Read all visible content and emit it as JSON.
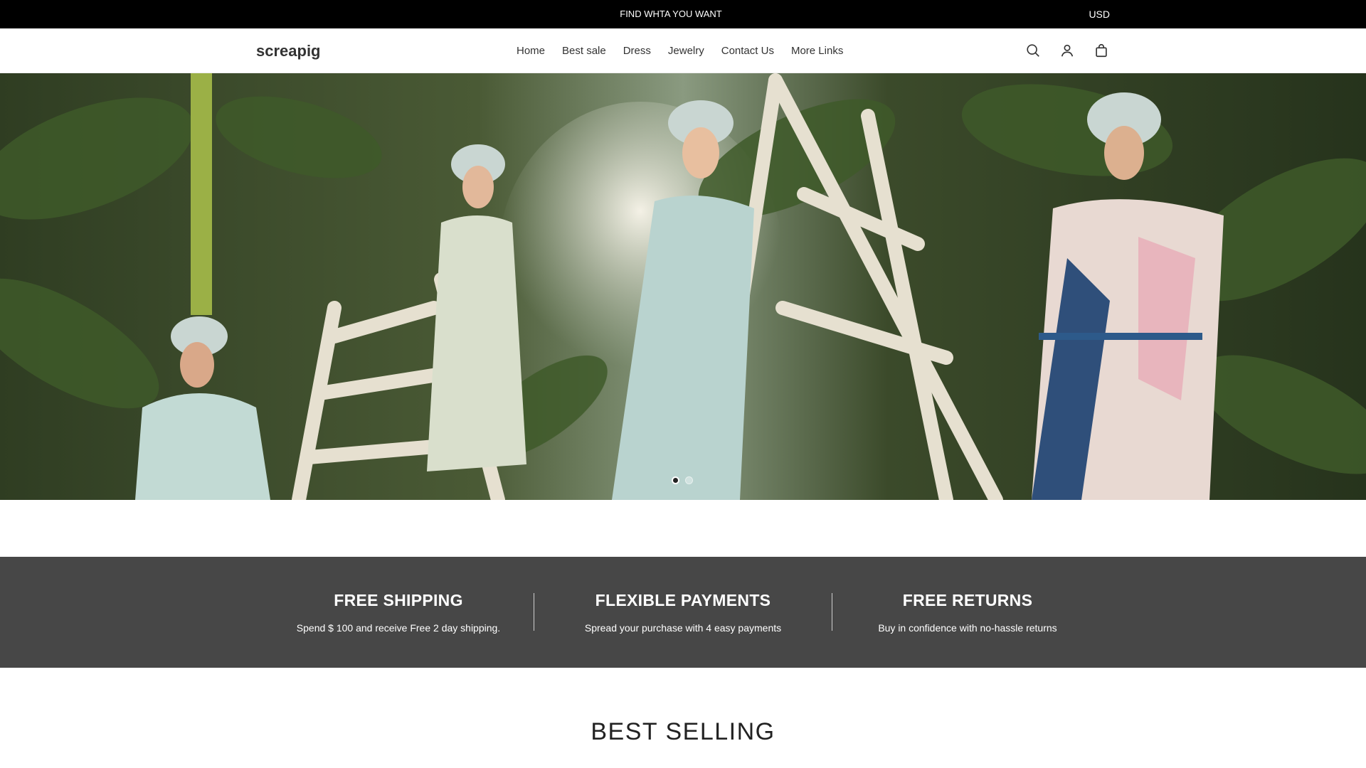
{
  "announcement": {
    "text": "FIND WHTA YOU WANT",
    "currency": "USD"
  },
  "header": {
    "logo": "screapig",
    "nav": [
      "Home",
      "Best sale",
      "Dress",
      "Jewelry",
      "Contact Us",
      "More Links"
    ],
    "icons": [
      "search-icon",
      "account-icon",
      "cart-icon"
    ]
  },
  "hero": {
    "slide_count": 2,
    "active_slide": 1
  },
  "features": [
    {
      "title": "FREE SHIPPING",
      "text": "Spend $ 100 and receive Free 2 day shipping."
    },
    {
      "title": "FLEXIBLE PAYMENTS",
      "text": "Spread your purchase with 4 easy payments"
    },
    {
      "title": "FREE RETURNS",
      "text": "Buy in confidence with no-hassle returns"
    }
  ],
  "best_selling": {
    "title": "BEST SELLING"
  },
  "colors": {
    "announce_bg": "#000000",
    "features_bg": "#474747"
  }
}
